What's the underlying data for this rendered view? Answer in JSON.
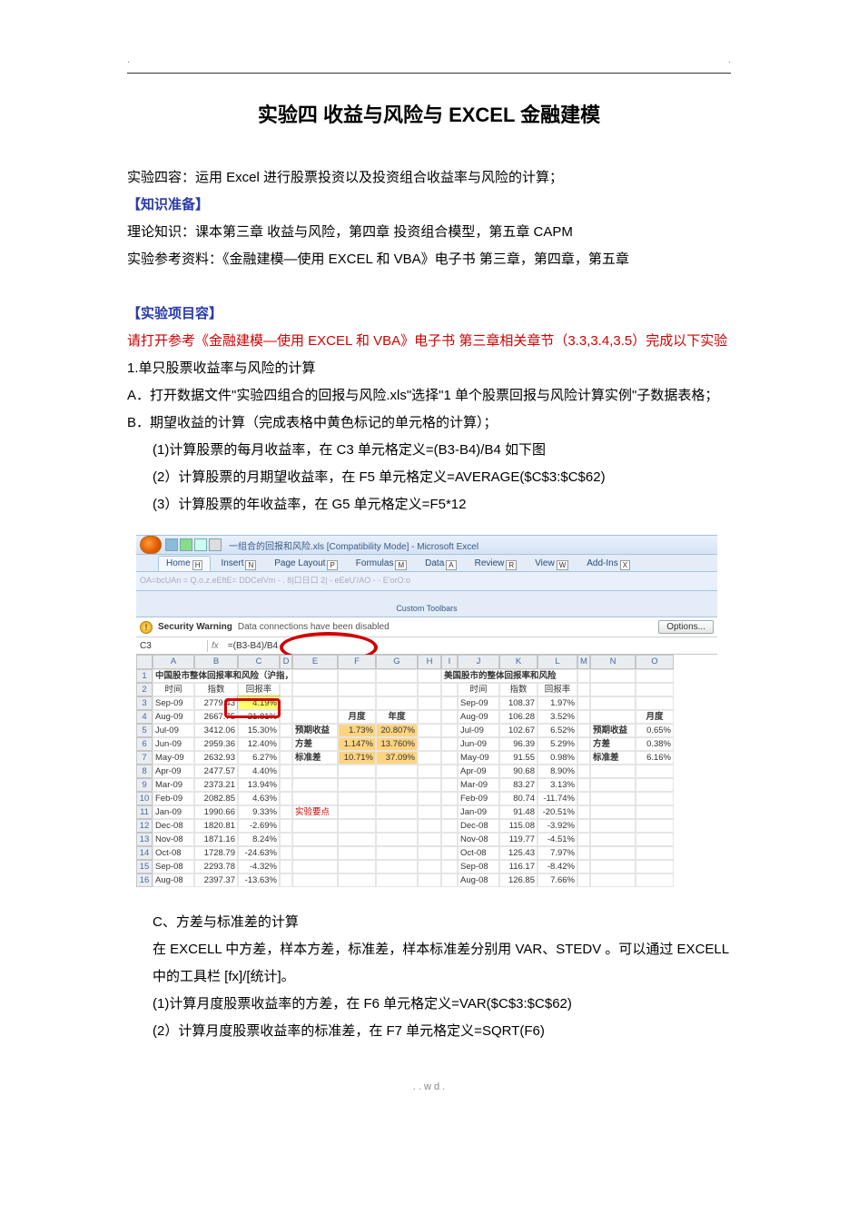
{
  "header": {
    "left": ".",
    "right": "."
  },
  "title": "实验四 收益与风险与 EXCEL  金融建模",
  "intro": "实验四容：运用 Excel 进行股票投资以及投资组合收益率与风险的计算；",
  "prep_label": "【知识准备】",
  "prep1": "理论知识：课本第三章 收益与风险，第四章 投资组合模型，第五章 CAPM",
  "prep2": "实验参考资料：《金融建模—使用 EXCEL 和 VBA》电子书 第三章，第四章，第五章",
  "proj_label": "【实验项目容】",
  "proj_red": "请打开参考《金融建模—使用 EXCEL 和 VBA》电子书 第三章相关章节（3.3,3.4,3.5）完成以下实验",
  "p1": "1.单只股票收益率与风险的计算",
  "pA": "A．打开数据文件\"实验四组合的回报与风险.xls\"选择\"1 单个股票回报与风险计算实例\"子数据表格；",
  "pB": "B．期望收益的计算（完成表格中黄色标记的单元格的计算）；",
  "pB1": "(1)计算股票的每月收益率，在 C3 单元格定义=(B3-B4)/B4 如下图",
  "pB2": "(2）计算股票的月期望收益率，在 F5 单元格定义=AVERAGE($C$3:$C$62)",
  "pB3": "(3）计算股票的年收益率，在 G5 单元格定义=F5*12",
  "pC": "C、方差与标准差的计算",
  "pC_text": "在 EXCELL 中方差，样本方差，标准差，样本标准差分别用 VAR、STEDV 。可以通过 EXCELL 中的工具栏 [fx]/[统计]。",
  "pC1": "(1)计算月度股票收益率的方差，在 F6 单元格定义=VAR($C$3:$C$62)",
  "pC2": "(2）计算月度股票收益率的标准差，在 F7 单元格定义=SQRT(F6)",
  "footer": ". . w d .",
  "excel": {
    "title_suffix": "一组合的回报和风险.xls [Compatibility Mode] - Microsoft Excel",
    "tabs": [
      "Home",
      "Insert",
      "Page Layout",
      "Formulas",
      "Data",
      "Review",
      "View",
      "Add-Ins"
    ],
    "tab_hotkeys": [
      "H",
      "N",
      "P",
      "M",
      "A",
      "R",
      "W",
      "X"
    ],
    "toolbar_hint": "OA=bcUAn = Q.o.z.eEftE= DDCelVm - . 8|口日口 2| - eEeU'/AO - - E'orO:o",
    "custom_toolbars": "Custom Toolbars",
    "warn_title": "Security Warning",
    "warn_msg": "Data connections have been disabled",
    "options": "Options...",
    "name_box": "C3",
    "formula": "=(B3-B4)/B4",
    "cols": [
      "A",
      "B",
      "C",
      "D",
      "E",
      "F",
      "G",
      "H",
      "I",
      "J",
      "K",
      "L",
      "M",
      "N",
      "O"
    ],
    "left_title": "中国股市整体回报率和风险（沪指，月度）",
    "right_title": "美国股市的整体回报率和风险",
    "hdr_time": "时间",
    "hdr_index": "指数",
    "hdr_ret": "回报率",
    "month_label": "月度",
    "year_label": "年度",
    "stat_exp": "预期收益",
    "stat_var": "方差",
    "stat_std": "标准差",
    "exp_note": "实验要点",
    "left_rows": [
      {
        "t": "Sep-09",
        "idx": "2779.43",
        "ret": "4.19%"
      },
      {
        "t": "Aug-09",
        "idx": "2667.75",
        "ret": "-21.81%"
      },
      {
        "t": "Jul-09",
        "idx": "3412.06",
        "ret": "15.30%"
      },
      {
        "t": "Jun-09",
        "idx": "2959.36",
        "ret": "12.40%"
      },
      {
        "t": "May-09",
        "idx": "2632.93",
        "ret": "6.27%"
      },
      {
        "t": "Apr-09",
        "idx": "2477.57",
        "ret": "4.40%"
      },
      {
        "t": "Mar-09",
        "idx": "2373.21",
        "ret": "13.94%"
      },
      {
        "t": "Feb-09",
        "idx": "2082.85",
        "ret": "4.63%"
      },
      {
        "t": "Jan-09",
        "idx": "1990.66",
        "ret": "9.33%"
      },
      {
        "t": "Dec-08",
        "idx": "1820.81",
        "ret": "-2.69%"
      },
      {
        "t": "Nov-08",
        "idx": "1871.16",
        "ret": "8.24%"
      },
      {
        "t": "Oct-08",
        "idx": "1728.79",
        "ret": "-24.63%"
      },
      {
        "t": "Sep-08",
        "idx": "2293.78",
        "ret": "-4.32%"
      },
      {
        "t": "Aug-08",
        "idx": "2397.37",
        "ret": "-13.63%"
      }
    ],
    "left_stats": {
      "exp_m": "1.73%",
      "exp_y": "20.807%",
      "var_m": "1.147%",
      "var_y": "13.760%",
      "std_m": "10.71%",
      "std_y": "37.09%"
    },
    "right_rows": [
      {
        "t": "Sep-09",
        "idx": "108.37",
        "ret": "1.97%"
      },
      {
        "t": "Aug-09",
        "idx": "106.28",
        "ret": "3.52%"
      },
      {
        "t": "Jul-09",
        "idx": "102.67",
        "ret": "6.52%"
      },
      {
        "t": "Jun-09",
        "idx": "96.39",
        "ret": "5.29%"
      },
      {
        "t": "May-09",
        "idx": "91.55",
        "ret": "0.98%"
      },
      {
        "t": "Apr-09",
        "idx": "90.68",
        "ret": "8.90%"
      },
      {
        "t": "Mar-09",
        "idx": "83.27",
        "ret": "3.13%"
      },
      {
        "t": "Feb-09",
        "idx": "80.74",
        "ret": "-11.74%"
      },
      {
        "t": "Jan-09",
        "idx": "91.48",
        "ret": "-20.51%"
      },
      {
        "t": "Dec-08",
        "idx": "115.08",
        "ret": "-3.92%"
      },
      {
        "t": "Nov-08",
        "idx": "119.77",
        "ret": "-4.51%"
      },
      {
        "t": "Oct-08",
        "idx": "125.43",
        "ret": "7.97%"
      },
      {
        "t": "Sep-08",
        "idx": "116.17",
        "ret": "-8.42%"
      },
      {
        "t": "Aug-08",
        "idx": "126.85",
        "ret": "7.66%"
      }
    ],
    "right_stats": {
      "exp_m": "0.65%",
      "var_m": "0.38%",
      "std_m": "6.16%"
    }
  }
}
